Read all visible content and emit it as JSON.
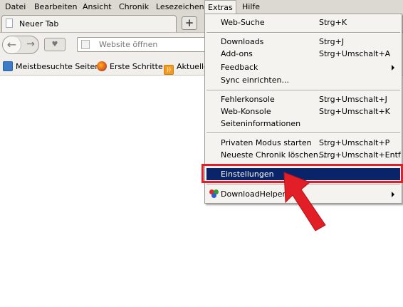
{
  "menubar": {
    "items": [
      {
        "label": "Datei"
      },
      {
        "label": "Bearbeiten"
      },
      {
        "label": "Ansicht"
      },
      {
        "label": "Chronik"
      },
      {
        "label": "Lesezeichen"
      },
      {
        "label": "Extras"
      },
      {
        "label": "Hilfe"
      }
    ]
  },
  "tab": {
    "label": "Neuer Tab",
    "new_tab_label": "+"
  },
  "navbar": {
    "back_icon": "back-arrow-icon",
    "forward_icon": "forward-arrow-icon",
    "url_placeholder": "Website öffnen"
  },
  "bookmarks": {
    "items": [
      {
        "label": "Meistbesuchte Seiten",
        "icon": "most-visited-icon"
      },
      {
        "label": "Erste Schritte",
        "icon": "firefox-icon"
      },
      {
        "label": "Aktuelle",
        "icon": "rss-icon"
      }
    ]
  },
  "extras_menu": {
    "items": [
      {
        "label": "Web-Suche",
        "shortcut": "Strg+K"
      },
      {
        "label": "Downloads",
        "shortcut": "Strg+J"
      },
      {
        "label": "Add-ons",
        "shortcut": "Strg+Umschalt+A"
      },
      {
        "label": "Feedback",
        "shortcut": ""
      },
      {
        "label": "Sync einrichten...",
        "shortcut": ""
      },
      {
        "label": "Fehlerkonsole",
        "shortcut": "Strg+Umschalt+J"
      },
      {
        "label": "Web-Konsole",
        "shortcut": "Strg+Umschalt+K"
      },
      {
        "label": "Seiteninformationen",
        "shortcut": ""
      },
      {
        "label": "Privaten Modus starten",
        "shortcut": "Strg+Umschalt+P"
      },
      {
        "label": "Neueste Chronik löschen...",
        "shortcut": "Strg+Umschalt+Entf"
      },
      {
        "label": "Einstellungen",
        "shortcut": ""
      },
      {
        "label": "DownloadHelper",
        "shortcut": "",
        "icon": "downloadhelper-icon"
      }
    ]
  },
  "colors": {
    "highlight": "#0a246a",
    "annotation_red": "#e21e26",
    "menubar_bg": "#dcd9d3"
  }
}
